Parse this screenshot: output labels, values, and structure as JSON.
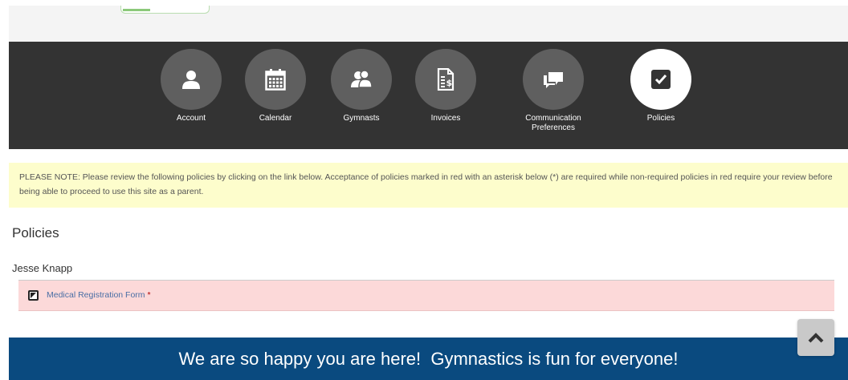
{
  "nav": {
    "items": [
      {
        "label": "Account",
        "icon": "user-icon"
      },
      {
        "label": "Calendar",
        "icon": "calendar-icon"
      },
      {
        "label": "Gymnasts",
        "icon": "users-icon"
      },
      {
        "label": "Invoices",
        "icon": "invoice-icon"
      },
      {
        "label": "Communication Preferences",
        "icon": "chat-icon"
      },
      {
        "label": "Policies",
        "icon": "checkbox-icon",
        "active": true
      }
    ]
  },
  "notice": {
    "text": "PLEASE NOTE: Please review the following policies by clicking on the link below. Acceptance of policies marked in red with an asterisk below (*) are required while non-required policies in red require your review before being able to proceed to use this site as a parent."
  },
  "policies": {
    "title": "Policies",
    "person": "Jesse Knapp",
    "items": [
      {
        "label": "Medical Registration Form",
        "required_marker": "*"
      }
    ]
  },
  "footer": {
    "text": "We are so happy you are here!  Gymnastics is fun for everyone!"
  },
  "colors": {
    "nav_bg": "#333333",
    "notice_bg": "#fdfdcc",
    "policy_row_bg": "#fcd9d9",
    "footer_bg": "#0a4a7f"
  }
}
